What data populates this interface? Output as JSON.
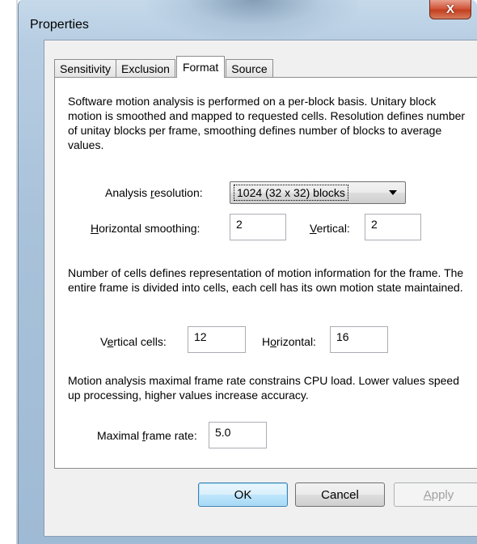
{
  "window": {
    "title": "Properties",
    "close_glyph": "X"
  },
  "tabs": [
    {
      "label": "Sensitivity",
      "active": false
    },
    {
      "label": "Exclusion",
      "active": false
    },
    {
      "label": "Format",
      "active": true
    },
    {
      "label": "Source",
      "active": false
    }
  ],
  "format": {
    "intro": "Software motion analysis is performed on a per-block basis. Unitary block motion is smoothed and mapped to requested cells. Resolution defines number of unitay blocks per frame, smoothing defines number of blocks to average values.",
    "analysis_resolution": {
      "pre": "Analysis ",
      "key": "r",
      "post": "esolution:",
      "value": "1024 (32 x 32) blocks"
    },
    "horizontal_smoothing": {
      "pre": "",
      "key": "H",
      "post": "orizontal smoothing:",
      "value": "2"
    },
    "vertical": {
      "pre": "",
      "key": "V",
      "post": "ertical:",
      "value": "2"
    },
    "cells_text": "Number of cells defines representation of motion information for the frame. The entire frame is divided into cells, each cell has its own motion state maintained.",
    "vertical_cells": {
      "pre": "V",
      "key": "e",
      "post": "rtical cells:",
      "value": "12"
    },
    "horizontal_cells": {
      "pre": "H",
      "key": "o",
      "post": "rizontal:",
      "value": "16"
    },
    "rate_text": "Motion analysis maximal frame rate constrains CPU load. Lower values speed up processing, higher values increase accuracy.",
    "max_frame_rate": {
      "pre": "Maximal ",
      "key": "f",
      "post": "rame rate:",
      "value": "5.0"
    }
  },
  "buttons": {
    "ok": "OK",
    "cancel": "Cancel",
    "apply": {
      "key": "A",
      "post": "pply"
    }
  }
}
